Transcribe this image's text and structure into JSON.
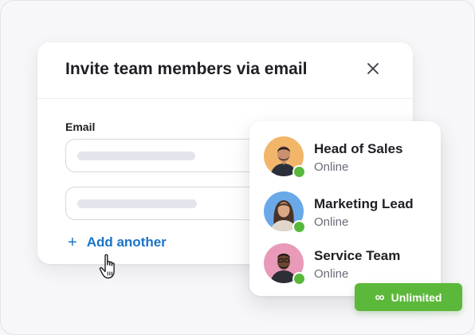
{
  "invite": {
    "title": "Invite team members via email",
    "close_icon": "close-icon",
    "email_label": "Email",
    "add_another_label": "Add another",
    "plus_icon": "+",
    "accent_color": "#1a73c8"
  },
  "team": {
    "members": [
      {
        "name": "Head of Sales",
        "status": "Online",
        "avatar_bg": "#f2b66a"
      },
      {
        "name": "Marketing Lead",
        "status": "Online",
        "avatar_bg": "#6aa9e8"
      },
      {
        "name": "Service Team",
        "status": "Online",
        "avatar_bg": "#e99ab8"
      }
    ],
    "online_color": "#58b83c"
  },
  "badge": {
    "icon": "∞",
    "label": "Unlimited",
    "color": "#5cb83a"
  }
}
